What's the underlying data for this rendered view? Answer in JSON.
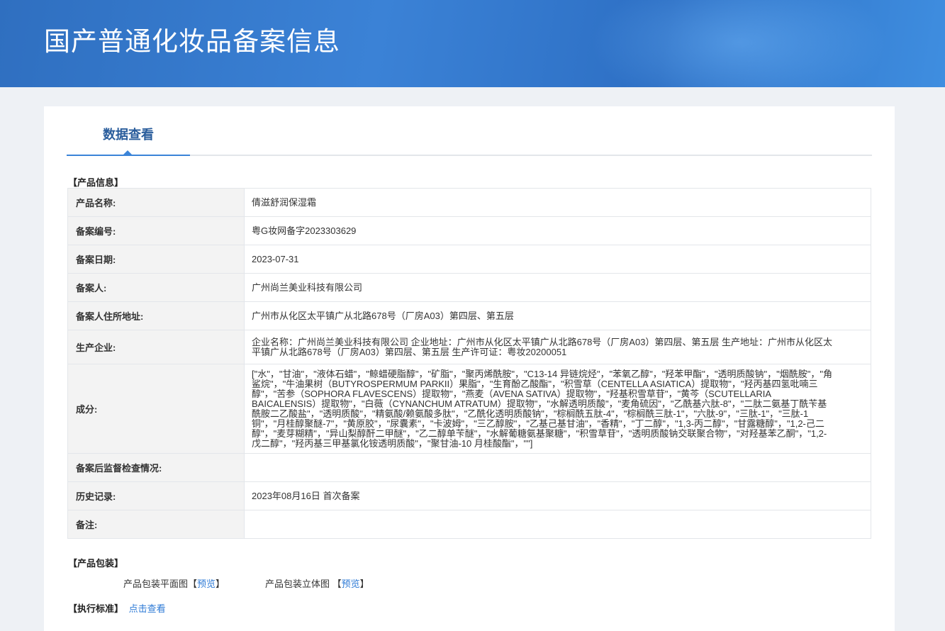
{
  "header": {
    "title": "国产普通化妆品备案信息"
  },
  "tabs": [
    {
      "label": "数据查看"
    }
  ],
  "product_info": {
    "section_title": "【产品信息】",
    "rows": [
      {
        "label": "产品名称:",
        "value": "倩滋舒润保湿霜"
      },
      {
        "label": "备案编号:",
        "value": "粤G妆网备字2023303629"
      },
      {
        "label": "备案日期:",
        "value": "2023-07-31"
      },
      {
        "label": "备案人:",
        "value": "广州尚兰美业科技有限公司"
      },
      {
        "label": "备案人住所地址:",
        "value": "广州市从化区太平镇广从北路678号（厂房A03）第四层、第五层"
      },
      {
        "label": "生产企业:",
        "value": "企业名称：广州尚兰美业科技有限公司 企业地址：广州市从化区太平镇广从北路678号（厂房A03）第四层、第五层 生产地址：广州市从化区太平镇广从北路678号（厂房A03）第四层、第五层 生产许可证：粤妆20200051"
      },
      {
        "label": "成分:",
        "value": "[\"水\"，\"甘油\"，\"液体石蜡\"，\"鲸蜡硬脂醇\"，\"矿脂\"，\"聚丙烯酰胺\"，\"C13-14 异链烷烃\"，\"苯氧乙醇\"，\"羟苯甲酯\"，\"透明质酸钠\"，\"烟酰胺\"，\"角鲨烷\"，\"牛油果树（BUTYROSPERMUM PARKII）果脂\"，\"生育酚乙酸酯\"，\"积雪草（CENTELLA ASIATICA）提取物\"，\"羟丙基四氢吡喃三醇\"，\"苦参（SOPHORA FLAVESCENS）提取物\"，\"燕麦（AVENA SATIVA）提取物\"，\"羟基积雪草苷\"，\"黄芩（SCUTELLARIA BAICALENSIS）提取物\"，\"白薇（CYNANCHUM ATRATUM）提取物\"，\"水解透明质酸\"，\"麦角硫因\"，\"乙酰基六肽-8\"，\"二肽二氨基丁酰苄基酰胺二乙酸盐\"，\"透明质酸\"，\"精氨酸/赖氨酸多肽\"，\"乙酰化透明质酸钠\"，\"棕榈酰五肽-4\"，\"棕榈酰三肽-1\"，\"六肽-9\"，\"三肽-1\"，\"三肽-1 铜\"，\"月桂醇聚醚-7\"，\"黄原胶\"，\"尿囊素\"，\"卡波姆\"，\"三乙醇胺\"，\"乙基己基甘油\"，\"香精\"，\"丁二醇\"，\"1,3-丙二醇\"，\"甘露糖醇\"，\"1,2-己二醇\"，\"麦芽糊精\"，\"异山梨醇酐二甲醚\"，\"乙二醇单苄醚\"，\"水解葡糖氨基聚糖\"，\"积雪草苷\"，\"透明质酸钠交联聚合物\"，\"对羟基苯乙酮\"，\"1,2-戊二醇\"，\"羟丙基三甲基氯化铵透明质酸\"，\"聚甘油-10 月桂酸酯\"，\"\"]"
      },
      {
        "label": "备案后监督检查情况:",
        "value": ""
      },
      {
        "label": "历史记录:",
        "value": "2023年08月16日 首次备案"
      },
      {
        "label": "备注:",
        "value": ""
      }
    ]
  },
  "packaging": {
    "section_title": "【产品包装】",
    "flat_label": "产品包装平面图",
    "flat_link": "预览",
    "solid_label": "产品包装立体图",
    "solid_link": "预览"
  },
  "standard": {
    "section_title": "【执行标准】",
    "link": "点击查看"
  }
}
